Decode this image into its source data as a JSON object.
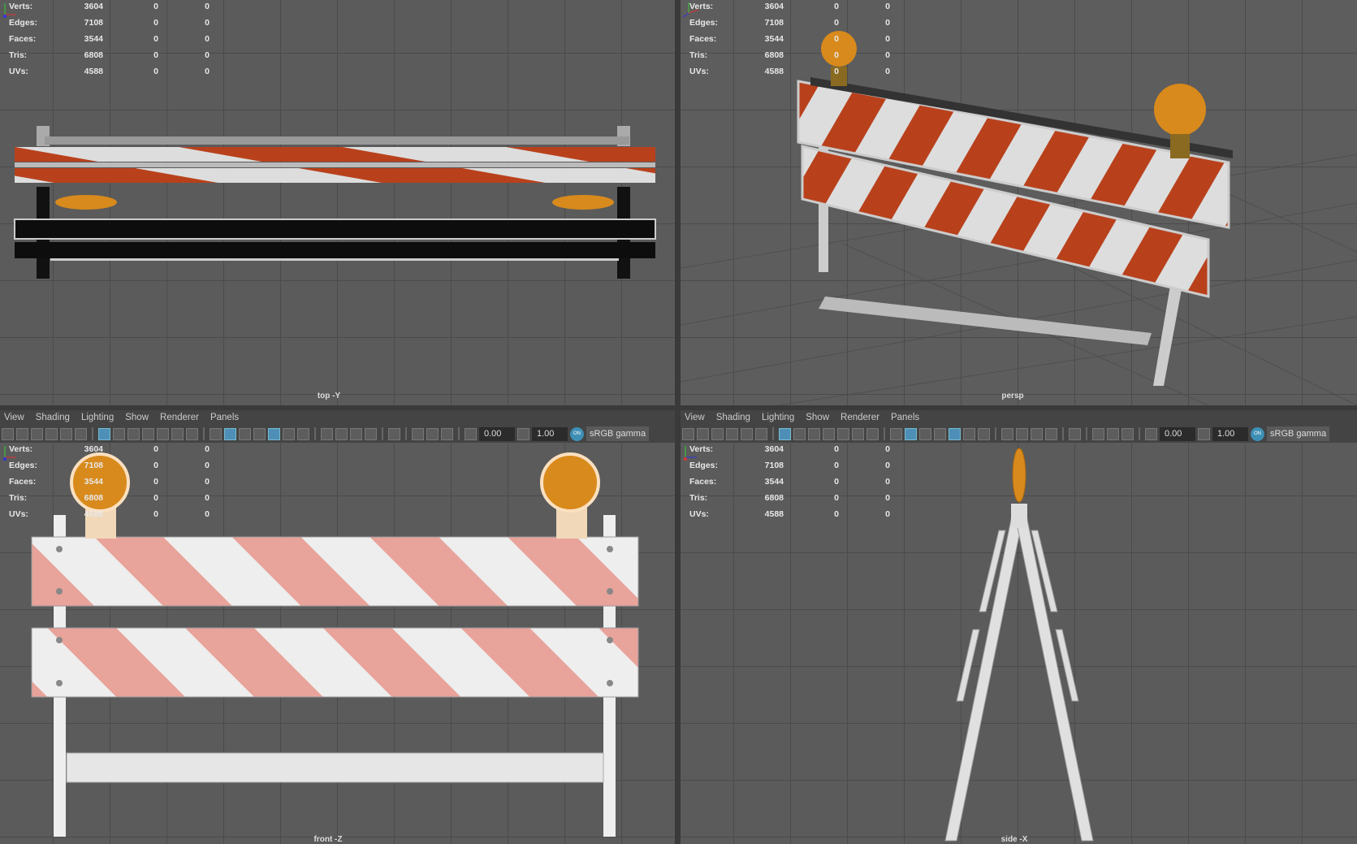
{
  "hud_rows": [
    {
      "label": "Verts:",
      "value": "3604",
      "sel": "0",
      "tri": "0"
    },
    {
      "label": "Edges:",
      "value": "7108",
      "sel": "0",
      "tri": "0"
    },
    {
      "label": "Faces:",
      "value": "3544",
      "sel": "0",
      "tri": "0"
    },
    {
      "label": "Tris:",
      "value": "6808",
      "sel": "0",
      "tri": "0"
    },
    {
      "label": "UVs:",
      "value": "4588",
      "sel": "0",
      "tri": "0"
    }
  ],
  "viewports": {
    "top": "top -Y",
    "persp": "persp",
    "front": "front -Z",
    "side": "side -X"
  },
  "menu": [
    "View",
    "Shading",
    "Lighting",
    "Show",
    "Renderer",
    "Panels"
  ],
  "toolbar": {
    "exposure": "0.00",
    "gamma": "1.00",
    "on_label": "ON",
    "color_space": "sRGB gamma"
  },
  "colors": {
    "stripe": "#b8411c",
    "stripe_front": "#e8a39a",
    "light": "#d88a1c",
    "accent": "#4e8fb8"
  }
}
